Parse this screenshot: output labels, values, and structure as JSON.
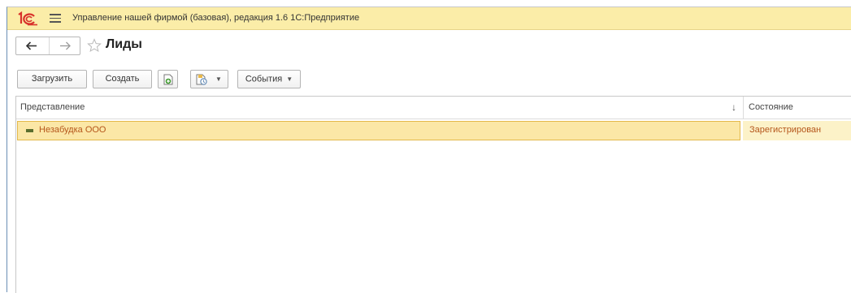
{
  "app": {
    "title": "Управление нашей фирмой (базовая), редакция 1.6 1С:Предприятие",
    "logo_icon": "1c-logo-icon",
    "menu_icon": "hamburger-menu-icon",
    "titlebar_color": "#fbeda8",
    "logo_color": "#d8322b"
  },
  "nav": {
    "back_icon": "arrow-left-icon",
    "forward_icon": "arrow-right-icon",
    "favorite_icon": "star-outline-icon",
    "page_title": "Лиды"
  },
  "toolbar": {
    "load_label": "Загрузить",
    "create_label": "Создать",
    "add_icon": "add-document-icon",
    "attach_icon": "document-print-icon",
    "events_label": "События"
  },
  "table": {
    "columns": [
      {
        "label": "Представление",
        "sort": "descending"
      },
      {
        "label": "Состояние"
      }
    ],
    "rows": [
      {
        "name": "Незабудка ООО",
        "state": "Зарегистрирован",
        "selected": true
      }
    ],
    "selection_color": "#fbe7a6",
    "selected_text_color": "#b5561b"
  }
}
